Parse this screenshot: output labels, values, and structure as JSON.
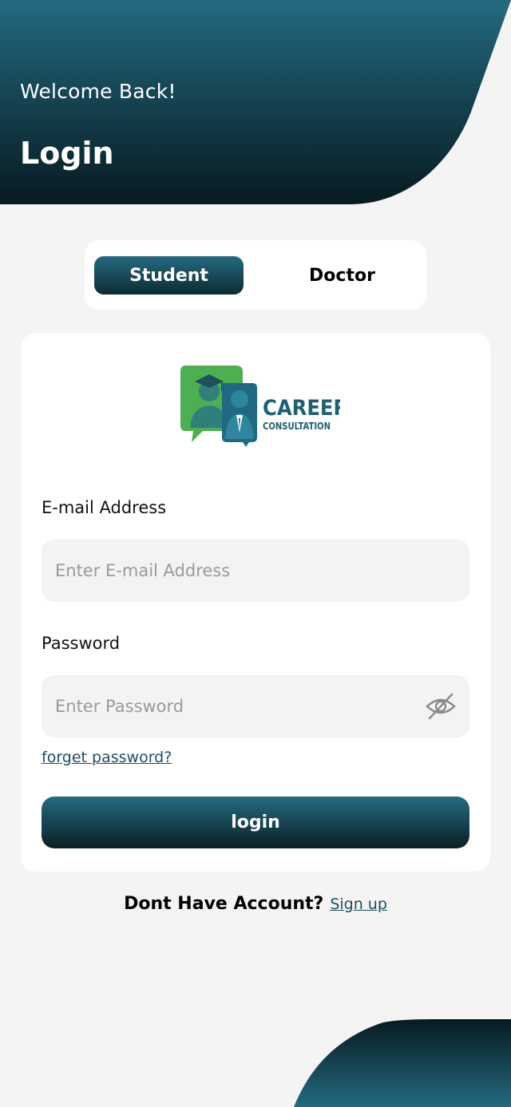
{
  "header": {
    "welcome": "Welcome Back!",
    "title": "Login"
  },
  "user_type": {
    "options": [
      "Student",
      "Doctor"
    ],
    "selected": "Student"
  },
  "logo": {
    "title": "CAREER",
    "subtitle": "CONSULTATION"
  },
  "form": {
    "email": {
      "label": "E-mail Address",
      "placeholder": "Enter E-mail Address",
      "value": ""
    },
    "password": {
      "label": "Password",
      "placeholder": "Enter Password",
      "value": ""
    },
    "forgot_label": "forget password?",
    "submit_label": "login"
  },
  "footer": {
    "question": "Dont Have Account?",
    "signup_label": "Sign up"
  },
  "colors": {
    "brand_light": "#246b80",
    "brand_dark": "#0a2026",
    "background": "#f4f4f4",
    "input_bg": "#f3f3f3",
    "logo_green": "#4caf50",
    "logo_teal": "#1f6a80"
  }
}
